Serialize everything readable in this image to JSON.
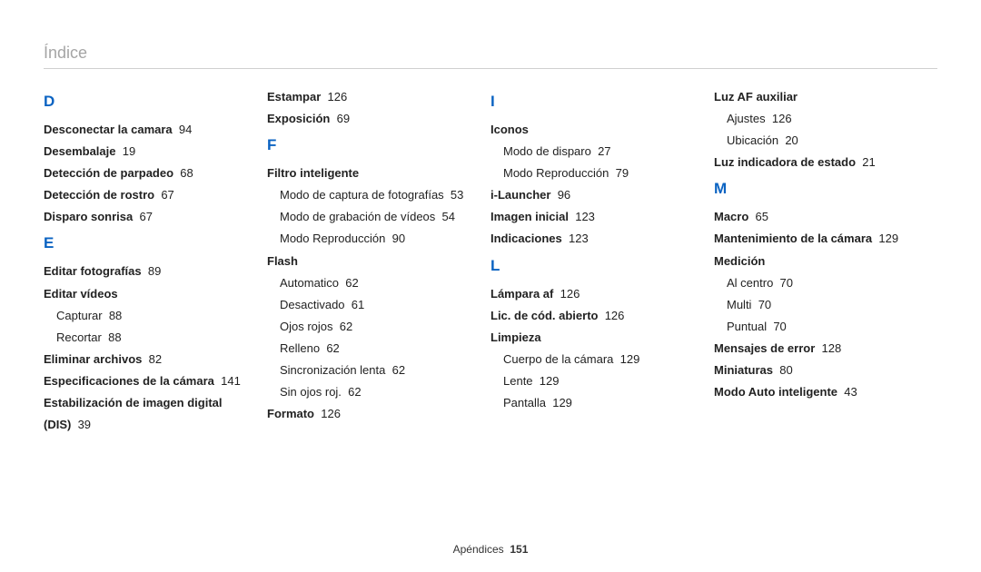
{
  "header": {
    "title": "Índice"
  },
  "footer": {
    "section": "Apéndices",
    "page": "151"
  },
  "col1": {
    "letterD": "D",
    "d1": "Desconectar la camara",
    "d1p": "94",
    "d2": "Desembalaje",
    "d2p": "19",
    "d3": "Detección de parpadeo",
    "d3p": "68",
    "d4": "Detección de rostro",
    "d4p": "67",
    "d5": "Disparo sonrisa",
    "d5p": "67",
    "letterE": "E",
    "e1": "Editar fotografías",
    "e1p": "89",
    "e2": "Editar vídeos",
    "e2a": "Capturar",
    "e2ap": "88",
    "e2b": "Recortar",
    "e2bp": "88",
    "e3": "Eliminar archivos",
    "e3p": "82",
    "e4": "Especificaciones de la cámara",
    "e4p": "141",
    "e5a": "Estabilización de imagen digital",
    "e5b": "(DIS)",
    "e5bp": "39"
  },
  "col2": {
    "e6": "Estampar",
    "e6p": "126",
    "e7": "Exposición",
    "e7p": "69",
    "letterF": "F",
    "f1": "Filtro inteligente",
    "f1a": "Modo de captura de fotografías",
    "f1ap": "53",
    "f1b": "Modo de grabación de vídeos",
    "f1bp": "54",
    "f1c": "Modo Reproducción",
    "f1cp": "90",
    "f2": "Flash",
    "f2a": "Automatico",
    "f2ap": "62",
    "f2b": "Desactivado",
    "f2bp": "61",
    "f2c": "Ojos rojos",
    "f2cp": "62",
    "f2d": "Relleno",
    "f2dp": "62",
    "f2e": "Sincronización lenta",
    "f2ep": "62",
    "f2f": "Sin ojos roj.",
    "f2fp": "62",
    "f3": "Formato",
    "f3p": "126"
  },
  "col3": {
    "letterI": "I",
    "i1": "Iconos",
    "i1a": "Modo de disparo",
    "i1ap": "27",
    "i1b": "Modo Reproducción",
    "i1bp": "79",
    "i2": "i-Launcher",
    "i2p": "96",
    "i3": "Imagen inicial",
    "i3p": "123",
    "i4": "Indicaciones",
    "i4p": "123",
    "letterL": "L",
    "l1": "Lámpara af",
    "l1p": "126",
    "l2": "Lic. de cód. abierto",
    "l2p": "126",
    "l3": "Limpieza",
    "l3a": "Cuerpo de la cámara",
    "l3ap": "129",
    "l3b": "Lente",
    "l3bp": "129",
    "l3c": "Pantalla",
    "l3cp": "129"
  },
  "col4": {
    "m0": "Luz AF auxiliar",
    "m0a": "Ajustes",
    "m0ap": "126",
    "m0b": "Ubicación",
    "m0bp": "20",
    "m1": "Luz indicadora de estado",
    "m1p": "21",
    "letterM": "M",
    "m2": "Macro",
    "m2p": "65",
    "m3": "Mantenimiento de la cámara",
    "m3p": "129",
    "m4": "Medición",
    "m4a": "Al centro",
    "m4ap": "70",
    "m4b": "Multi",
    "m4bp": "70",
    "m4c": "Puntual",
    "m4cp": "70",
    "m5": "Mensajes de error",
    "m5p": "128",
    "m6": "Miniaturas",
    "m6p": "80",
    "m7": "Modo Auto inteligente",
    "m7p": "43"
  }
}
